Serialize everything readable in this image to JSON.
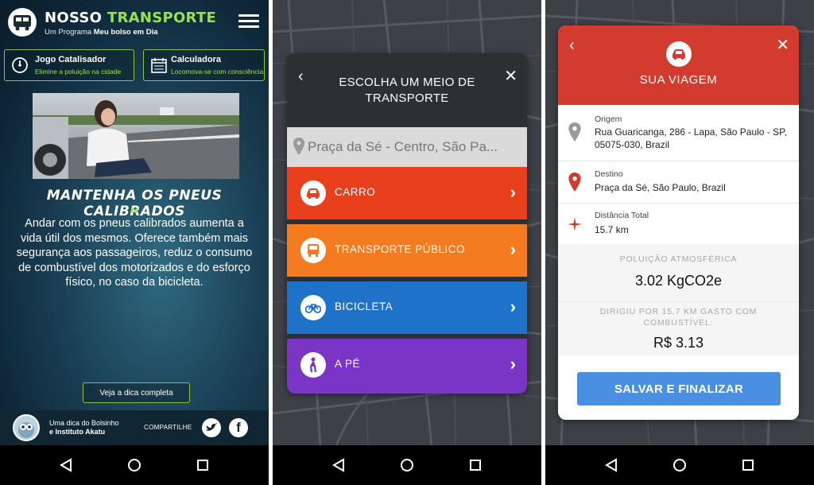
{
  "screen1": {
    "brand_main": "NOSSO ",
    "brand_accent": "TRANSPORTE",
    "subtitle_prefix": "Um Programa ",
    "subtitle_bold": "Meu bolso em Dia",
    "tile_game_title": "Jogo Catalisador",
    "tile_game_sub": "Elimine a poluição na cidade",
    "tile_calc_title": "Calculadora",
    "tile_calc_sub": "Locomova-se com consciência",
    "tip_title": "MANTENHA OS PNEUS CALIBRADOS",
    "quote_mark": "“",
    "tip_body": "Andar com os pneus calibrados aumenta a vida útil dos mesmos. Oferece também mais segurança aos passageiros, reduz o consumo de combustível dos motorizados e do esforço físico, no caso da bicicleta.",
    "tip_button": "Veja a dica completa",
    "credit_line1": "Uma dica do Bolsinho",
    "credit_line2": "e Instituto Akatu",
    "share_label": "COMPARTILHE"
  },
  "screen2": {
    "title": "ESCOLHA UM MEIO DE TRANSPORTE",
    "search_value": "Praça da Sé - Centro, São Pa...",
    "options": [
      {
        "label": "CARRO",
        "color": "#e8401c",
        "icon": "car-icon"
      },
      {
        "label": "TRANSPORTE PÚBLICO",
        "color": "#f47b20",
        "icon": "bus-icon"
      },
      {
        "label": "BICICLETA",
        "color": "#1e73c8",
        "icon": "bike-icon"
      },
      {
        "label": "A PÉ",
        "color": "#7a35c6",
        "icon": "walk-icon"
      }
    ]
  },
  "screen3": {
    "title": "SUA VIAGEM",
    "origin_label": "Origem",
    "origin_value": "Rua Guaricanga, 286 - Lapa, São Paulo - SP, 05075-030, Brazil",
    "dest_label": "Destino",
    "dest_value": "Praça da Sé, São Paulo, Brazil",
    "dist_label": "Distância Total",
    "dist_value": "15.7 km",
    "pollution_label": "POLUIÇÃO ATMOSFÉRICA",
    "pollution_value": "3.02 KgCO2e",
    "cost_label": "DIRIGIU POR 15,7 KM GASTO COM COMBUSTÍVEL:",
    "cost_value": "R$ 3.13",
    "save_button": "SALVAR E FINALIZAR",
    "header_color": "#d23b2d",
    "button_color": "#4a90e2"
  }
}
